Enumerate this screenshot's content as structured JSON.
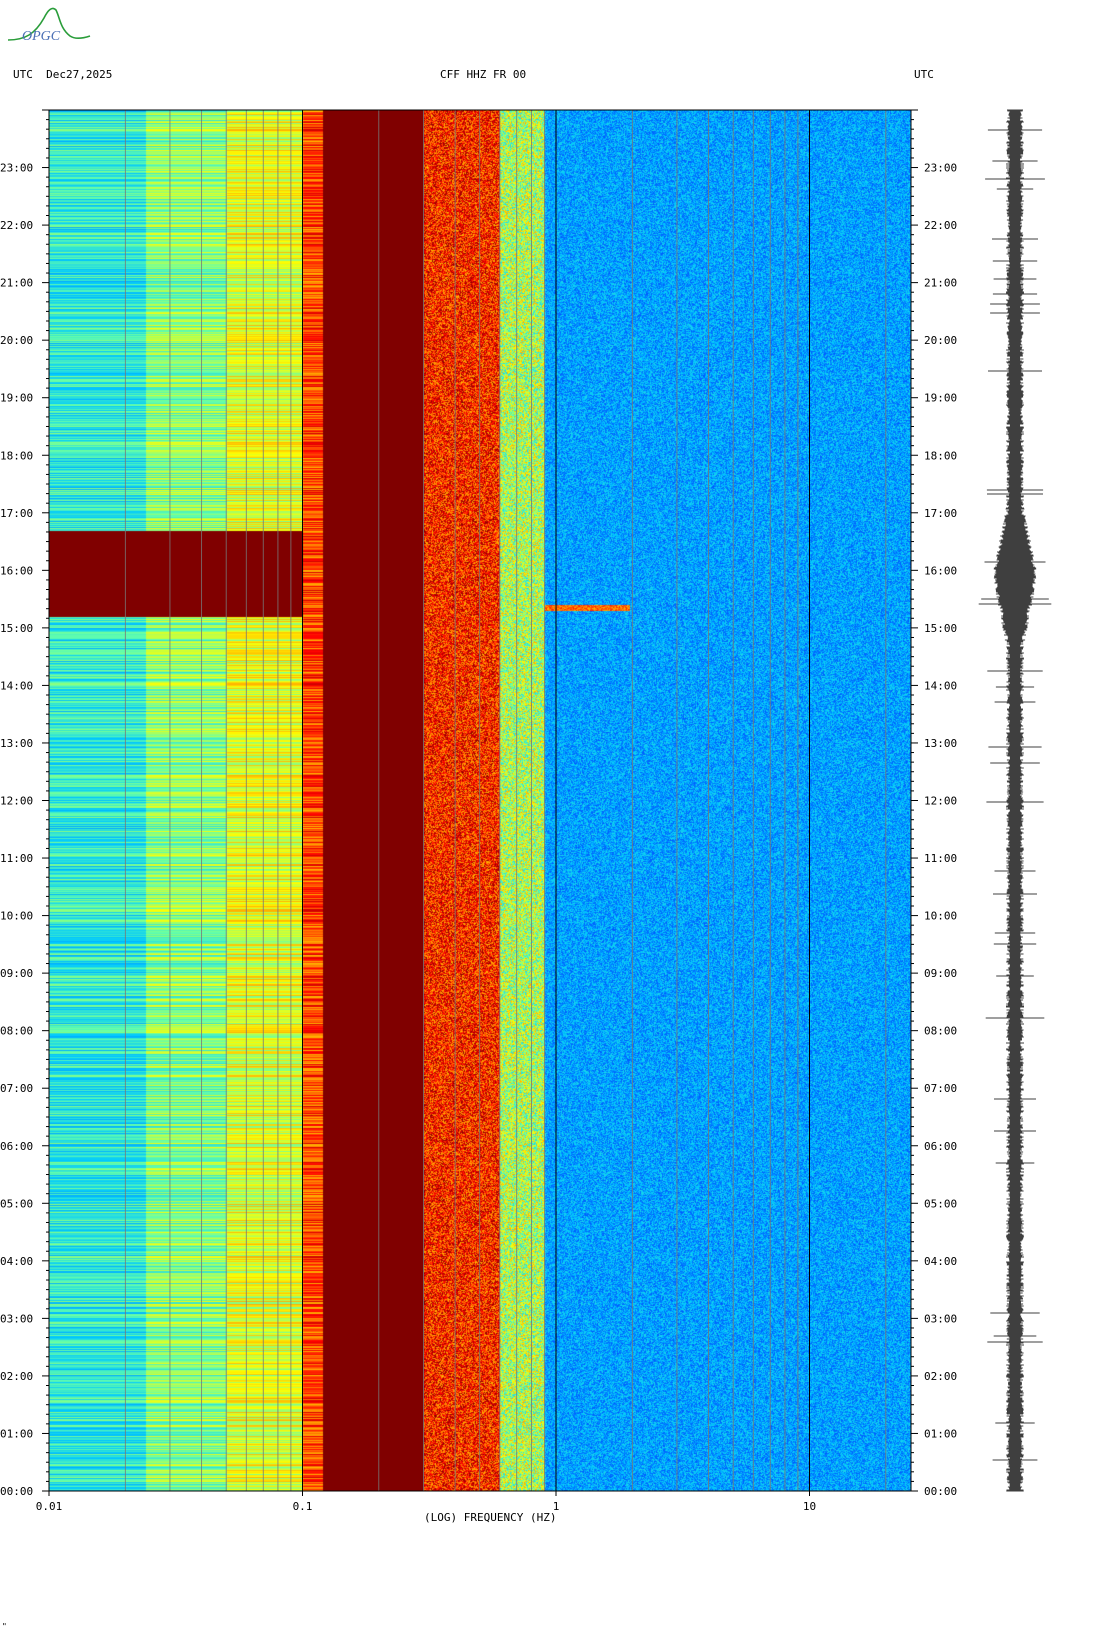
{
  "logo": {
    "text": "OPGC",
    "color": "#4a6fb5",
    "curve_color": "#2a9d3a"
  },
  "header": {
    "left": "UTC  Dec27,2025",
    "center": "CFF HHZ FR 00",
    "right": "UTC"
  },
  "chart_data": {
    "type": "heatmap",
    "subtype": "spectrogram",
    "xlabel": "(LOG) FREQUENCY (HZ)",
    "x_scale": "log",
    "xlim_hz": [
      0.01,
      25
    ],
    "x_ticks": [
      {
        "value": 0.01,
        "label": "0.01"
      },
      {
        "value": 0.1,
        "label": "0.1"
      },
      {
        "value": 1,
        "label": "1"
      },
      {
        "value": 10,
        "label": "10"
      }
    ],
    "y_unit": "UTC hour",
    "ylim_hours": [
      0,
      24
    ],
    "y_ticks": [
      "00:00",
      "01:00",
      "02:00",
      "03:00",
      "04:00",
      "05:00",
      "06:00",
      "07:00",
      "08:00",
      "09:00",
      "10:00",
      "11:00",
      "12:00",
      "13:00",
      "14:00",
      "15:00",
      "16:00",
      "17:00",
      "18:00",
      "19:00",
      "20:00",
      "21:00",
      "22:00",
      "23:00"
    ],
    "colormap": [
      "#0000c8",
      "#0050ff",
      "#00c8ff",
      "#64ffaa",
      "#ffff00",
      "#ff8000",
      "#ff0000",
      "#800000"
    ],
    "event": {
      "start_hour": 15.2,
      "end_hour": 16.7,
      "peak_hour": 15.35,
      "peak_freq_hz": 1.5
    },
    "frequency_bands": [
      {
        "f_min": 0.01,
        "f_max": 0.024,
        "level": 0.36
      },
      {
        "f_min": 0.024,
        "f_max": 0.05,
        "level": 0.46
      },
      {
        "f_min": 0.05,
        "f_max": 0.1,
        "level": 0.55
      },
      {
        "f_min": 0.1,
        "f_max": 0.12,
        "level": 0.78
      },
      {
        "f_min": 0.12,
        "f_max": 0.3,
        "level": 1.0
      },
      {
        "f_min": 0.3,
        "f_max": 0.6,
        "level": 0.82
      },
      {
        "f_min": 0.6,
        "f_max": 0.9,
        "level": 0.5
      },
      {
        "f_min": 0.9,
        "f_max": 25,
        "level": 0.15
      }
    ]
  },
  "seismogram": {
    "color": "#000000",
    "event_hour": 15.9
  },
  "footer": {
    "mark": "\""
  }
}
